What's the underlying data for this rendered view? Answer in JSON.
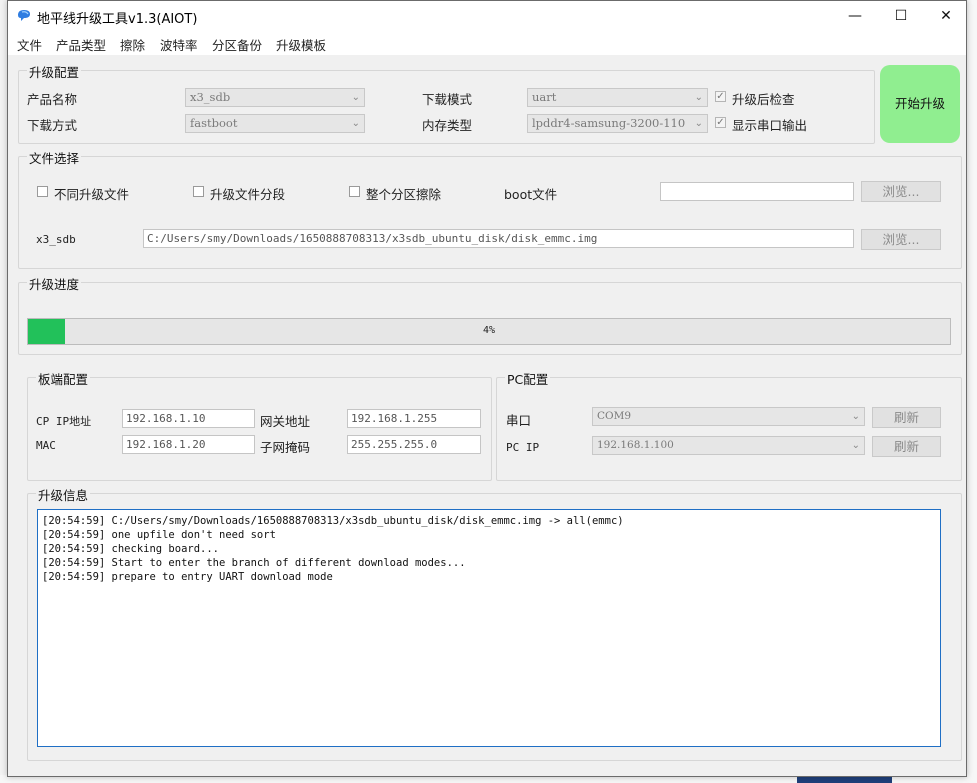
{
  "window": {
    "title": "地平线升级工具v1.3(AIOT)",
    "controls": {
      "minimize": "—",
      "maximize": "☐",
      "close": "✕"
    }
  },
  "menu": [
    "文件",
    "产品类型",
    "擦除",
    "波特率",
    "分区备份",
    "升级模板"
  ],
  "upgrade_config": {
    "title": "升级配置",
    "product_name_label": "产品名称",
    "product_name_value": "x3_sdb",
    "download_method_label": "下载方式",
    "download_method_value": "fastboot",
    "download_mode_label": "下载模式",
    "download_mode_value": "uart",
    "memory_type_label": "内存类型",
    "memory_type_value": "lpddr4-samsung-3200-110",
    "check_after_upgrade": {
      "label": "升级后检查",
      "checked": true
    },
    "show_serial_output": {
      "label": "显示串口输出",
      "checked": true
    },
    "start_button": "开始升级"
  },
  "file_select": {
    "title": "文件选择",
    "opt_diff_files": "不同升级文件",
    "opt_segment": "升级文件分段",
    "opt_erase_partition": "整个分区擦除",
    "boot_file_label": "boot文件",
    "boot_file_value": "",
    "browse_label": "浏览...",
    "image_label": "x3_sdb",
    "image_path": "C:/Users/smy/Downloads/1650888708313/x3sdb_ubuntu_disk/disk_emmc.img"
  },
  "progress": {
    "title": "升级进度",
    "percent": 4,
    "text": "4%"
  },
  "board_config": {
    "title": "板端配置",
    "cp_ip_label": "CP IP地址",
    "cp_ip_value": "192.168.1.10",
    "gateway_label": "网关地址",
    "gateway_value": "192.168.1.255",
    "mac_label": "MAC",
    "mac_value": "192.168.1.20",
    "subnet_label": "子网掩码",
    "subnet_value": "255.255.255.0"
  },
  "pc_config": {
    "title": "PC配置",
    "serial_label": "串口",
    "serial_value": "COM9",
    "pc_ip_label": "PC IP",
    "pc_ip_value": "192.168.1.100",
    "refresh_label": "刷新"
  },
  "log": {
    "title": "升级信息",
    "lines": [
      "[20:54:59] C:/Users/smy/Downloads/1650888708313/x3sdb_ubuntu_disk/disk_emmc.img -> all(emmc)",
      "[20:54:59] one upfile don't need sort",
      "[20:54:59] checking board...",
      "[20:54:59] Start to enter the branch of different download modes...",
      "[20:54:59] prepare to entry UART download mode"
    ]
  },
  "colors": {
    "accent_green": "#90ee90",
    "progress_green": "#22c15a",
    "log_border": "#1f6fc5"
  }
}
